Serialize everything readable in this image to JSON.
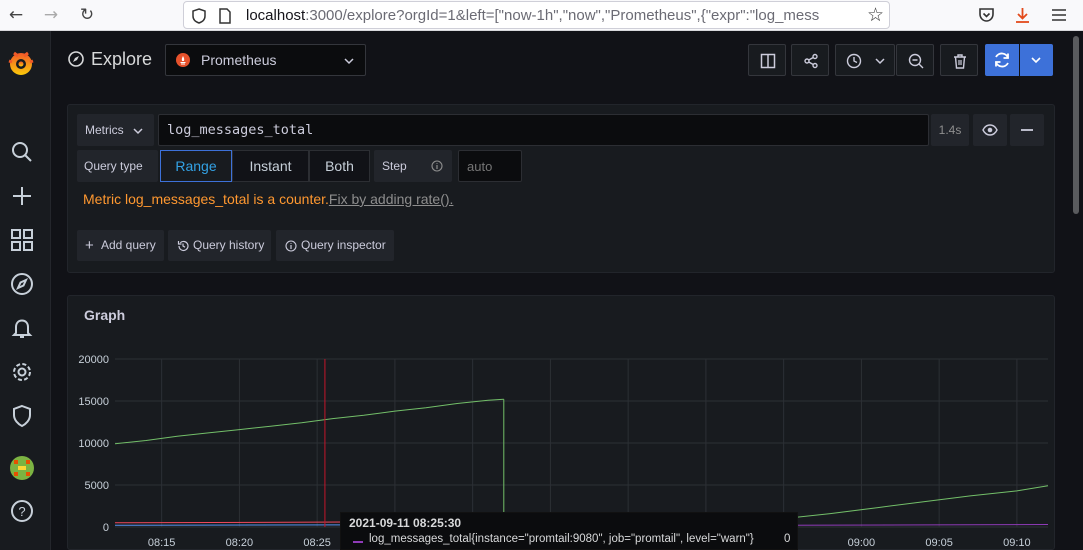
{
  "browser": {
    "url_host": "localhost",
    "url_rest": ":3000/explore?orgId=1&left=[\"now-1h\",\"now\",\"Prometheus\",{\"expr\":\"log_mess"
  },
  "header": {
    "title": "Explore",
    "datasource": "Prometheus"
  },
  "query": {
    "metrics_label": "Metrics",
    "expr": "log_messages_total",
    "duration": "1.4s",
    "query_type_label": "Query type",
    "types": [
      "Range",
      "Instant",
      "Both"
    ],
    "active_type": "Range",
    "step_label": "Step",
    "step_placeholder": "auto",
    "warning_text": "Metric log_messages_total is a counter.",
    "warning_fix": "Fix by adding rate().",
    "actions": {
      "add_query": "Add query",
      "history": "Query history",
      "inspector": "Query inspector"
    }
  },
  "graph": {
    "title": "Graph"
  },
  "chart_data": {
    "type": "line",
    "y_ticks": [
      "20000",
      "15000",
      "10000",
      "5000",
      "0"
    ],
    "x_ticks": [
      "08:15",
      "08:20",
      "08:25",
      "09:00",
      "09:05",
      "09:10"
    ],
    "ylim": [
      0,
      20000
    ],
    "series": [
      {
        "color": "#73bf69",
        "segments": [
          {
            "x": [
              "08:12",
              "08:14",
              "08:16",
              "08:18",
              "08:20",
              "08:22",
              "08:24",
              "08:26",
              "08:28",
              "08:30",
              "08:32",
              "08:34",
              "08:36",
              "08:37"
            ],
            "y": [
              9900,
              10300,
              10800,
              11200,
              11600,
              12000,
              12400,
              12900,
              13300,
              13800,
              14200,
              14700,
              15100,
              15200
            ]
          },
          {
            "x": [
              "08:37",
              "08:37"
            ],
            "y": [
              15200,
              0
            ]
          },
          {
            "x": [
              "08:55",
              "08:58",
              "09:01",
              "09:04",
              "09:07",
              "09:10",
              "09:12"
            ],
            "y": [
              1000,
              1600,
              2300,
              3000,
              3700,
              4300,
              4900
            ]
          }
        ]
      },
      {
        "color": "#f2495c",
        "segments": [
          {
            "x": [
              "08:12",
              "08:27"
            ],
            "y": [
              500,
              600
            ]
          }
        ]
      },
      {
        "color": "#8f3bb8",
        "segments": [
          {
            "x": [
              "08:55",
              "09:12"
            ],
            "y": [
              200,
              300
            ]
          }
        ]
      },
      {
        "color": "#5794f2",
        "segments": [
          {
            "x": [
              "08:12",
              "08:27"
            ],
            "y": [
              200,
              250
            ]
          }
        ]
      }
    ],
    "hover_time": "08:25:30",
    "tooltip": {
      "time": "2021-09-11 08:25:30",
      "series": "log_messages_total{instance=\"promtail:9080\", job=\"promtail\", level=\"warn\"}",
      "value": "0",
      "color": "#8f3bb8"
    }
  }
}
